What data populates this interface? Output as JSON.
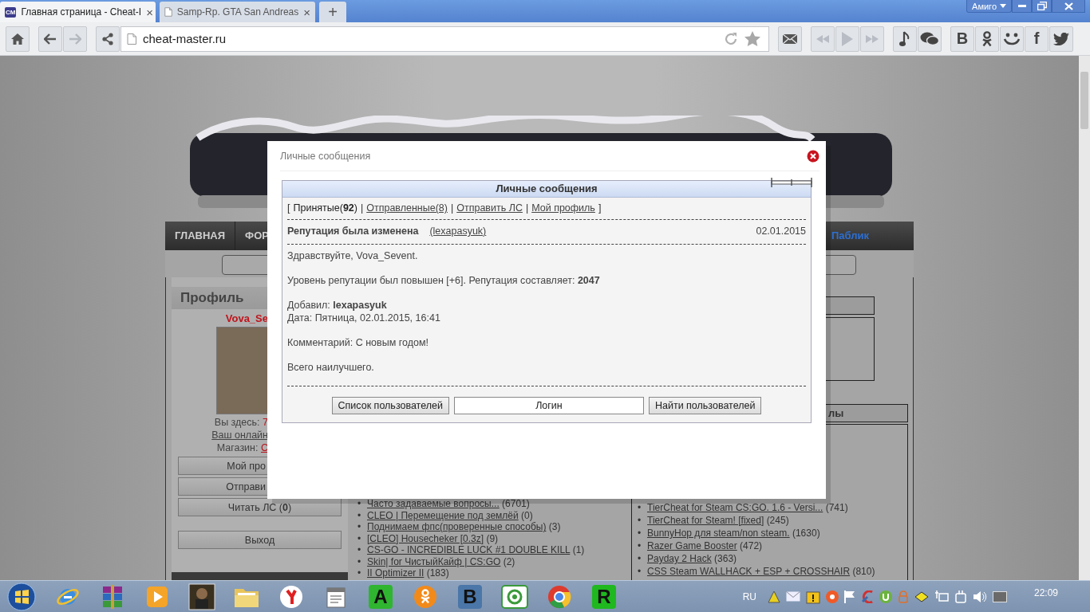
{
  "browser": {
    "tabs": [
      {
        "title": "Главная страница - Cheat-I",
        "favicon": "CM",
        "close": "×",
        "selected": true
      },
      {
        "title": "Samp-Rp. GTA San Andreas",
        "close": "×",
        "selected": false
      }
    ],
    "new_tab": "+",
    "profile_button": "Амиго",
    "address": "cheat-master.ru",
    "forward_disabled": true,
    "media_disabled": true,
    "vk_label": "В",
    "facebook_label": "f"
  },
  "site": {
    "bullet": "•",
    "nav": [
      {
        "label": "ГЛАВНАЯ",
        "kind": "main"
      },
      {
        "label": "ФОР",
        "kind": "main"
      },
      {
        "label": "Паблик",
        "kind": "link"
      }
    ],
    "profile": {
      "title": "Профиль",
      "name": "Vova_Se",
      "here_label": "Вы здесь:",
      "here_value": "7",
      "online_link": "Ваш онлайн",
      "shop_label": "Магазин:",
      "shop_link": "С",
      "buttons": [
        {
          "label": "Мой про",
          "cut": true
        },
        {
          "label": "Отправи",
          "cut": true
        },
        {
          "label": "Читать ЛС (**0**)",
          "cut": false
        }
      ],
      "logout": "Выход"
    },
    "middle_list": [
      {
        "title": "Часто задаваемые вопросы...",
        "count": "(6701)"
      },
      {
        "title": "CLEO | Перемещение под землёй",
        "count": "(0)"
      },
      {
        "title": "Поднимаем фпс(проверенные способы)",
        "count": "(3)"
      },
      {
        "title": "[CLEO] Housecheker [0.3z]",
        "count": "(9)"
      },
      {
        "title": "CS-GO - INCREDIBLE LUCK #1 DOUBLE KILL",
        "count": "(1)"
      },
      {
        "title": "Skin| for ЧистыйКайф | CS:GO",
        "count": "(2)"
      },
      {
        "title": "II Optimizer II",
        "count": "(183)"
      }
    ],
    "right_header": "лы",
    "right_list": [
      {
        "title": "TierCheat for Steam CS:GO. 1.6 - Versi...",
        "count": "(741)"
      },
      {
        "title": "TierCheat for Steam! [fixed]",
        "count": "(245)"
      },
      {
        "title": "BunnyHop для steam/non steam.",
        "count": "(1630)"
      },
      {
        "title": "Razer Game Booster",
        "count": "(472)"
      },
      {
        "title": "Payday 2 Hack",
        "count": "(363)"
      },
      {
        "title": "CSS Steam WALLHACK + ESP + CROSSHAIR",
        "count": "(810)"
      }
    ]
  },
  "dialog": {
    "title": "Личные сообщения",
    "panel_title": "Личные сообщения",
    "open": "[",
    "close": "]",
    "separator": "|",
    "tabs": [
      {
        "label": "Принятые(**92**)",
        "selected": true
      },
      {
        "label": "Отправленные(8)",
        "selected": false
      },
      {
        "label": "Отправить ЛС",
        "selected": false
      },
      {
        "label": "Мой профиль",
        "selected": false
      }
    ],
    "message": {
      "subject": "Репутация была изменена",
      "author": "(lexapasyuk)",
      "date": "02.01.2015",
      "paragraphs": [
        [
          "Здравствуйте, Vova_Sevent."
        ],
        [
          "Уровень репутации был повышен [+6]. Репутация составляет: **2047**"
        ],
        [
          "Добавил: **lexapasyuk**",
          "Дата: Пятница, 02.01.2015, 16:41"
        ],
        [
          "Комментарий: С новым годом!"
        ],
        [
          "Всего наилучшего."
        ]
      ]
    },
    "users_button": "Список пользователей",
    "login_value": "Логин",
    "find_button": "Найти пользователей"
  },
  "taskbar": {
    "apps": [
      {
        "kind": "ie"
      },
      {
        "kind": "archive"
      },
      {
        "kind": "player"
      },
      {
        "kind": "game"
      },
      {
        "kind": "folder"
      },
      {
        "kind": "yandex"
      },
      {
        "kind": "notepad"
      },
      {
        "kind": "letter",
        "label": "A",
        "color": "#2fb52f"
      },
      {
        "kind": "ok"
      },
      {
        "kind": "letter",
        "label": "В",
        "color": "#4a76a8"
      },
      {
        "kind": "mail"
      },
      {
        "kind": "chrome"
      },
      {
        "kind": "letter",
        "label": "R",
        "color": "#1fb81f"
      }
    ],
    "language": "RU",
    "clock": "22:09"
  }
}
